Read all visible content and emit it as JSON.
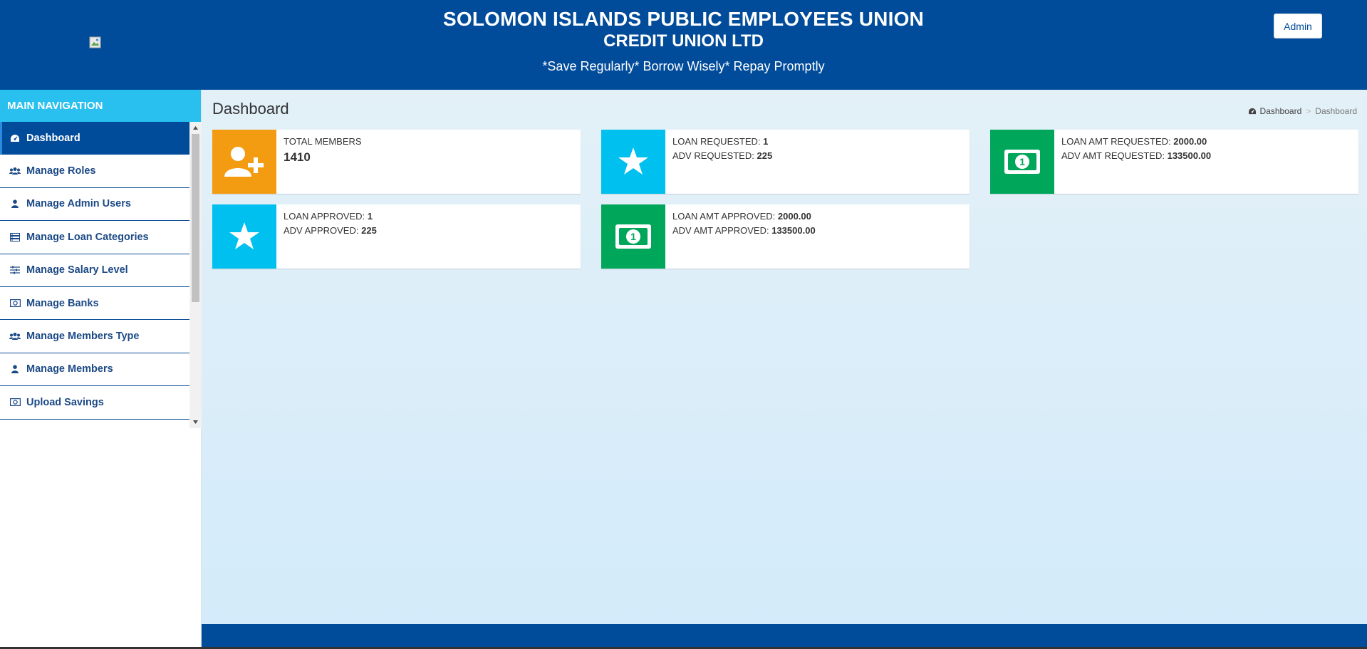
{
  "header": {
    "title_line1": "SOLOMON ISLANDS PUBLIC EMPLOYEES UNION",
    "title_line2": "CREDIT UNION LTD",
    "tagline": "*Save Regularly* Borrow Wisely* Repay Promptly",
    "admin_label": "Admin"
  },
  "sidebar": {
    "heading": "MAIN NAVIGATION",
    "items": [
      {
        "label": "Dashboard",
        "icon": "dashboard-icon",
        "active": true
      },
      {
        "label": "Manage Roles",
        "icon": "users-icon"
      },
      {
        "label": "Manage Admin Users",
        "icon": "user-icon"
      },
      {
        "label": "Manage Loan Categories",
        "icon": "server-icon"
      },
      {
        "label": "Manage Salary Level",
        "icon": "sliders-icon"
      },
      {
        "label": "Manage Banks",
        "icon": "money-icon"
      },
      {
        "label": "Manage Members Type",
        "icon": "users-icon"
      },
      {
        "label": "Manage Members",
        "icon": "user-icon"
      },
      {
        "label": "Upload Savings",
        "icon": "money-icon"
      }
    ]
  },
  "main": {
    "page_title": "Dashboard",
    "breadcrumb": {
      "home": "Dashboard",
      "current": "Dashboard"
    },
    "cards": {
      "members": {
        "label": "TOTAL MEMBERS",
        "value": "1410",
        "icon": "user-plus-icon",
        "color": "#f39c12"
      },
      "requested": {
        "loan_label": "LOAN REQUESTED:",
        "loan_value": "1",
        "adv_label": "ADV REQUESTED:",
        "adv_value": "225",
        "icon": "star-icon",
        "color": "#00c0ef"
      },
      "amt_requested": {
        "loan_label": "LOAN AMT REQUESTED:",
        "loan_value": "2000.00",
        "adv_label": "ADV AMT REQUESTED:",
        "adv_value": "133500.00",
        "icon": "money-bill-icon",
        "color": "#00a65a"
      },
      "approved": {
        "loan_label": "LOAN APPROVED:",
        "loan_value": "1",
        "adv_label": "ADV APPROVED:",
        "adv_value": "225",
        "icon": "star-icon",
        "color": "#00c0ef"
      },
      "amt_approved": {
        "loan_label": "LOAN AMT APPROVED:",
        "loan_value": "2000.00",
        "adv_label": "ADV AMT APPROVED:",
        "adv_value": "133500.00",
        "icon": "money-bill-icon",
        "color": "#00a65a"
      }
    }
  },
  "colors": {
    "brand": "#004b9a",
    "nav_head": "#29c0f0"
  }
}
